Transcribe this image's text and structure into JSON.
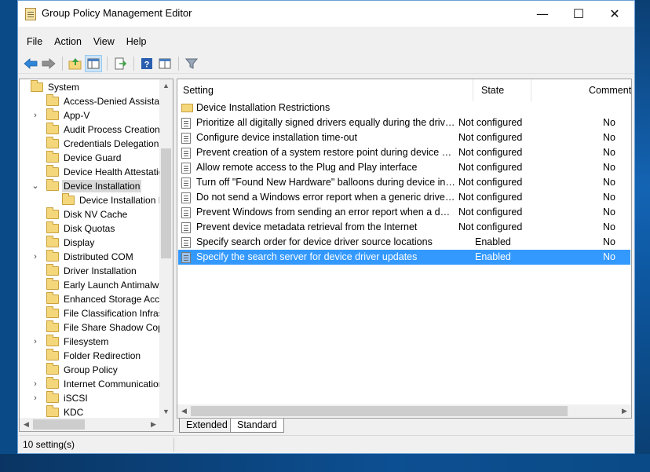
{
  "window": {
    "title": "Group Policy Management Editor",
    "minimize": "—",
    "maximize": "☐",
    "close": "✕"
  },
  "menu": [
    "File",
    "Action",
    "View",
    "Help"
  ],
  "toolbar": {
    "icons": [
      "back-icon",
      "forward-icon",
      "up-folder-icon",
      "show-hide-tree-icon",
      "export-list-icon",
      "help-icon",
      "properties-icon",
      "filter-icon"
    ]
  },
  "tree": {
    "items": [
      {
        "label": "System",
        "expander": "",
        "depth": 0
      },
      {
        "label": "Access-Denied Assistance",
        "expander": "",
        "depth": 1
      },
      {
        "label": "App-V",
        "expander": ">",
        "depth": 1
      },
      {
        "label": "Audit Process Creation",
        "expander": "",
        "depth": 1
      },
      {
        "label": "Credentials Delegation",
        "expander": "",
        "depth": 1
      },
      {
        "label": "Device Guard",
        "expander": "",
        "depth": 1
      },
      {
        "label": "Device Health Attestation",
        "expander": "",
        "depth": 1
      },
      {
        "label": "Device Installation",
        "expander": "v",
        "depth": 1,
        "selected": true
      },
      {
        "label": "Device Installation Restrictions",
        "expander": "",
        "depth": 2
      },
      {
        "label": "Disk NV Cache",
        "expander": "",
        "depth": 1
      },
      {
        "label": "Disk Quotas",
        "expander": "",
        "depth": 1
      },
      {
        "label": "Display",
        "expander": "",
        "depth": 1
      },
      {
        "label": "Distributed COM",
        "expander": ">",
        "depth": 1
      },
      {
        "label": "Driver Installation",
        "expander": "",
        "depth": 1
      },
      {
        "label": "Early Launch Antimalware",
        "expander": "",
        "depth": 1
      },
      {
        "label": "Enhanced Storage Access",
        "expander": "",
        "depth": 1
      },
      {
        "label": "File Classification Infrastructure",
        "expander": "",
        "depth": 1
      },
      {
        "label": "File Share Shadow Copy",
        "expander": "",
        "depth": 1
      },
      {
        "label": "Filesystem",
        "expander": ">",
        "depth": 1
      },
      {
        "label": "Folder Redirection",
        "expander": "",
        "depth": 1
      },
      {
        "label": "Group Policy",
        "expander": "",
        "depth": 1
      },
      {
        "label": "Internet Communication",
        "expander": ">",
        "depth": 1
      },
      {
        "label": "iSCSI",
        "expander": ">",
        "depth": 1
      },
      {
        "label": "KDC",
        "expander": "",
        "depth": 1
      }
    ]
  },
  "list": {
    "headers": {
      "setting": "Setting",
      "state": "State",
      "comment": "Comment"
    },
    "folder_row": "Device Installation Restrictions",
    "rows": [
      {
        "setting": "Prioritize all digitally signed drivers equally during the driver ...",
        "state": "Not configured",
        "comment": "No"
      },
      {
        "setting": "Configure device installation time-out",
        "state": "Not configured",
        "comment": "No"
      },
      {
        "setting": "Prevent creation of a system restore point during device acti...",
        "state": "Not configured",
        "comment": "No"
      },
      {
        "setting": "Allow remote access to the Plug and Play interface",
        "state": "Not configured",
        "comment": "No"
      },
      {
        "setting": "Turn off \"Found New Hardware\" balloons during device inst...",
        "state": "Not configured",
        "comment": "No"
      },
      {
        "setting": "Do not send a Windows error report when a generic driver is...",
        "state": "Not configured",
        "comment": "No"
      },
      {
        "setting": "Prevent Windows from sending an error report when a devic...",
        "state": "Not configured",
        "comment": "No"
      },
      {
        "setting": "Prevent device metadata retrieval from the Internet",
        "state": "Not configured",
        "comment": "No"
      },
      {
        "setting": "Specify search order for device driver source locations",
        "state": "Enabled",
        "comment": "No"
      },
      {
        "setting": "Specify the search server for device driver updates",
        "state": "Enabled",
        "comment": "No",
        "selected": true
      }
    ]
  },
  "tabs": {
    "extended": "Extended",
    "standard": "Standard",
    "active": "Standard"
  },
  "status": {
    "text": "10 setting(s)"
  },
  "colors": {
    "selection": "#3399ff",
    "tree_selection": "#d9d9d9"
  }
}
